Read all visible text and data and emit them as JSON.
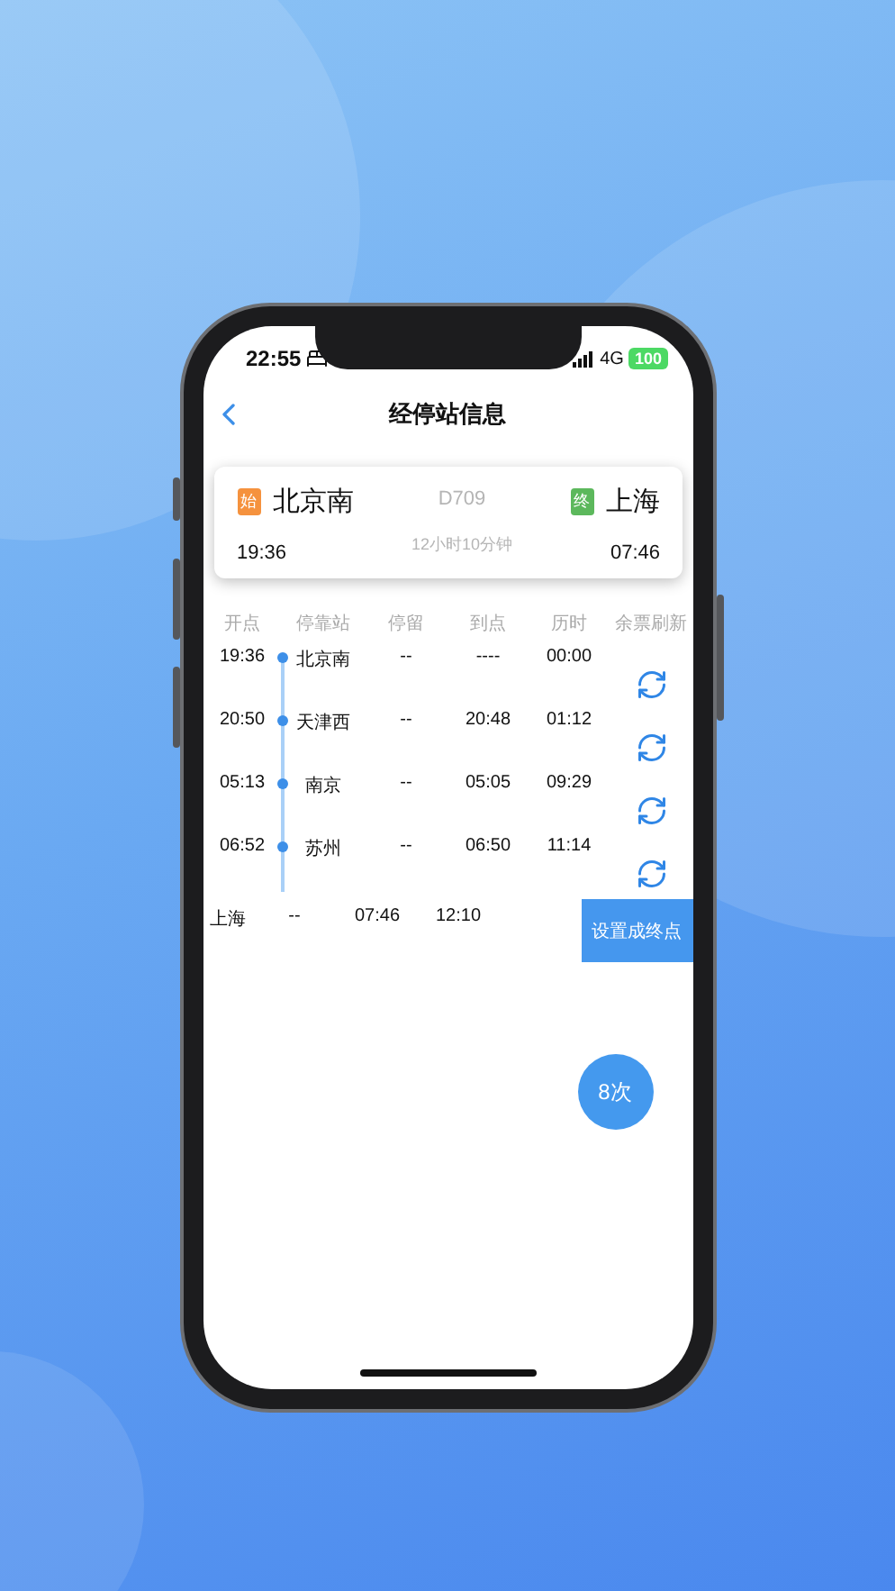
{
  "status_bar": {
    "time": "22:55",
    "network": "4G",
    "battery": "100"
  },
  "nav": {
    "title": "经停站信息"
  },
  "train_card": {
    "from": {
      "badge": "始",
      "station": "北京南",
      "time": "19:36"
    },
    "train_no": "D709",
    "duration": "12小时10分钟",
    "to": {
      "badge": "终",
      "station": "上海",
      "time": "07:46"
    }
  },
  "columns": [
    "开点",
    "停靠站",
    "停留",
    "到点",
    "历时",
    "余票刷新"
  ],
  "stops": [
    {
      "depart": "19:36",
      "station": "北京南",
      "stay": "--",
      "arrive": "----",
      "elapsed": "00:00"
    },
    {
      "depart": "20:50",
      "station": "天津西",
      "stay": "--",
      "arrive": "20:48",
      "elapsed": "01:12"
    },
    {
      "depart": "05:13",
      "station": "南京",
      "stay": "--",
      "arrive": "05:05",
      "elapsed": "09:29"
    },
    {
      "depart": "06:52",
      "station": "苏州",
      "stay": "--",
      "arrive": "06:50",
      "elapsed": "11:14"
    }
  ],
  "terminal": {
    "station": "上海",
    "stay": "--",
    "arrive": "07:46",
    "elapsed": "12:10"
  },
  "set_end_button": "设置成终点",
  "count_badge": "8次"
}
